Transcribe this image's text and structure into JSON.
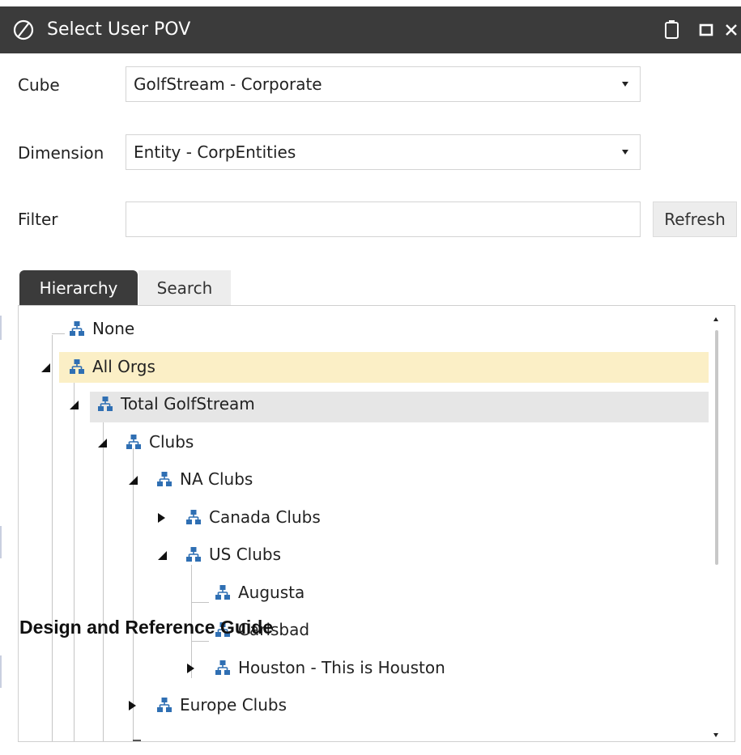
{
  "window": {
    "title": "Select User POV",
    "icon": "oneStream-logo-icon",
    "buttons": [
      "clipboard-icon",
      "maximize-icon",
      "close-icon"
    ]
  },
  "form": {
    "cube_label": "Cube",
    "cube_value": "GolfStream - Corporate",
    "dimension_label": "Dimension",
    "dimension_value": "Entity - CorpEntities",
    "filter_label": "Filter",
    "filter_value": "",
    "refresh_label": "Refresh"
  },
  "tabs": [
    {
      "label": "Hierarchy",
      "active": true
    },
    {
      "label": "Search",
      "active": false
    }
  ],
  "tree": [
    {
      "label": "None",
      "level": 0,
      "expander": "none"
    },
    {
      "label": "All Orgs",
      "level": 0,
      "expander": "open",
      "state": "highlighted"
    },
    {
      "label": "Total GolfStream",
      "level": 1,
      "expander": "open",
      "state": "selected"
    },
    {
      "label": "Clubs",
      "level": 2,
      "expander": "open"
    },
    {
      "label": "NA Clubs",
      "level": 3,
      "expander": "open"
    },
    {
      "label": "Canada Clubs",
      "level": 4,
      "expander": "closed"
    },
    {
      "label": "US Clubs",
      "level": 4,
      "expander": "open"
    },
    {
      "label": "Augusta",
      "level": 5,
      "expander": "none"
    },
    {
      "label": "Carlsbad",
      "level": 5,
      "expander": "none"
    },
    {
      "label": "Houston - This is Houston",
      "level": 5,
      "expander": "closed"
    },
    {
      "label": "Europe Clubs",
      "level": 3,
      "expander": "closed"
    }
  ],
  "overlay_caption": "Design and Reference Guide",
  "colors": {
    "titlebar": "#3b3b3b",
    "highlight_row": "#fbefc6",
    "selected_row": "#e6e6e6",
    "node_icon": "#2f6fb3"
  }
}
